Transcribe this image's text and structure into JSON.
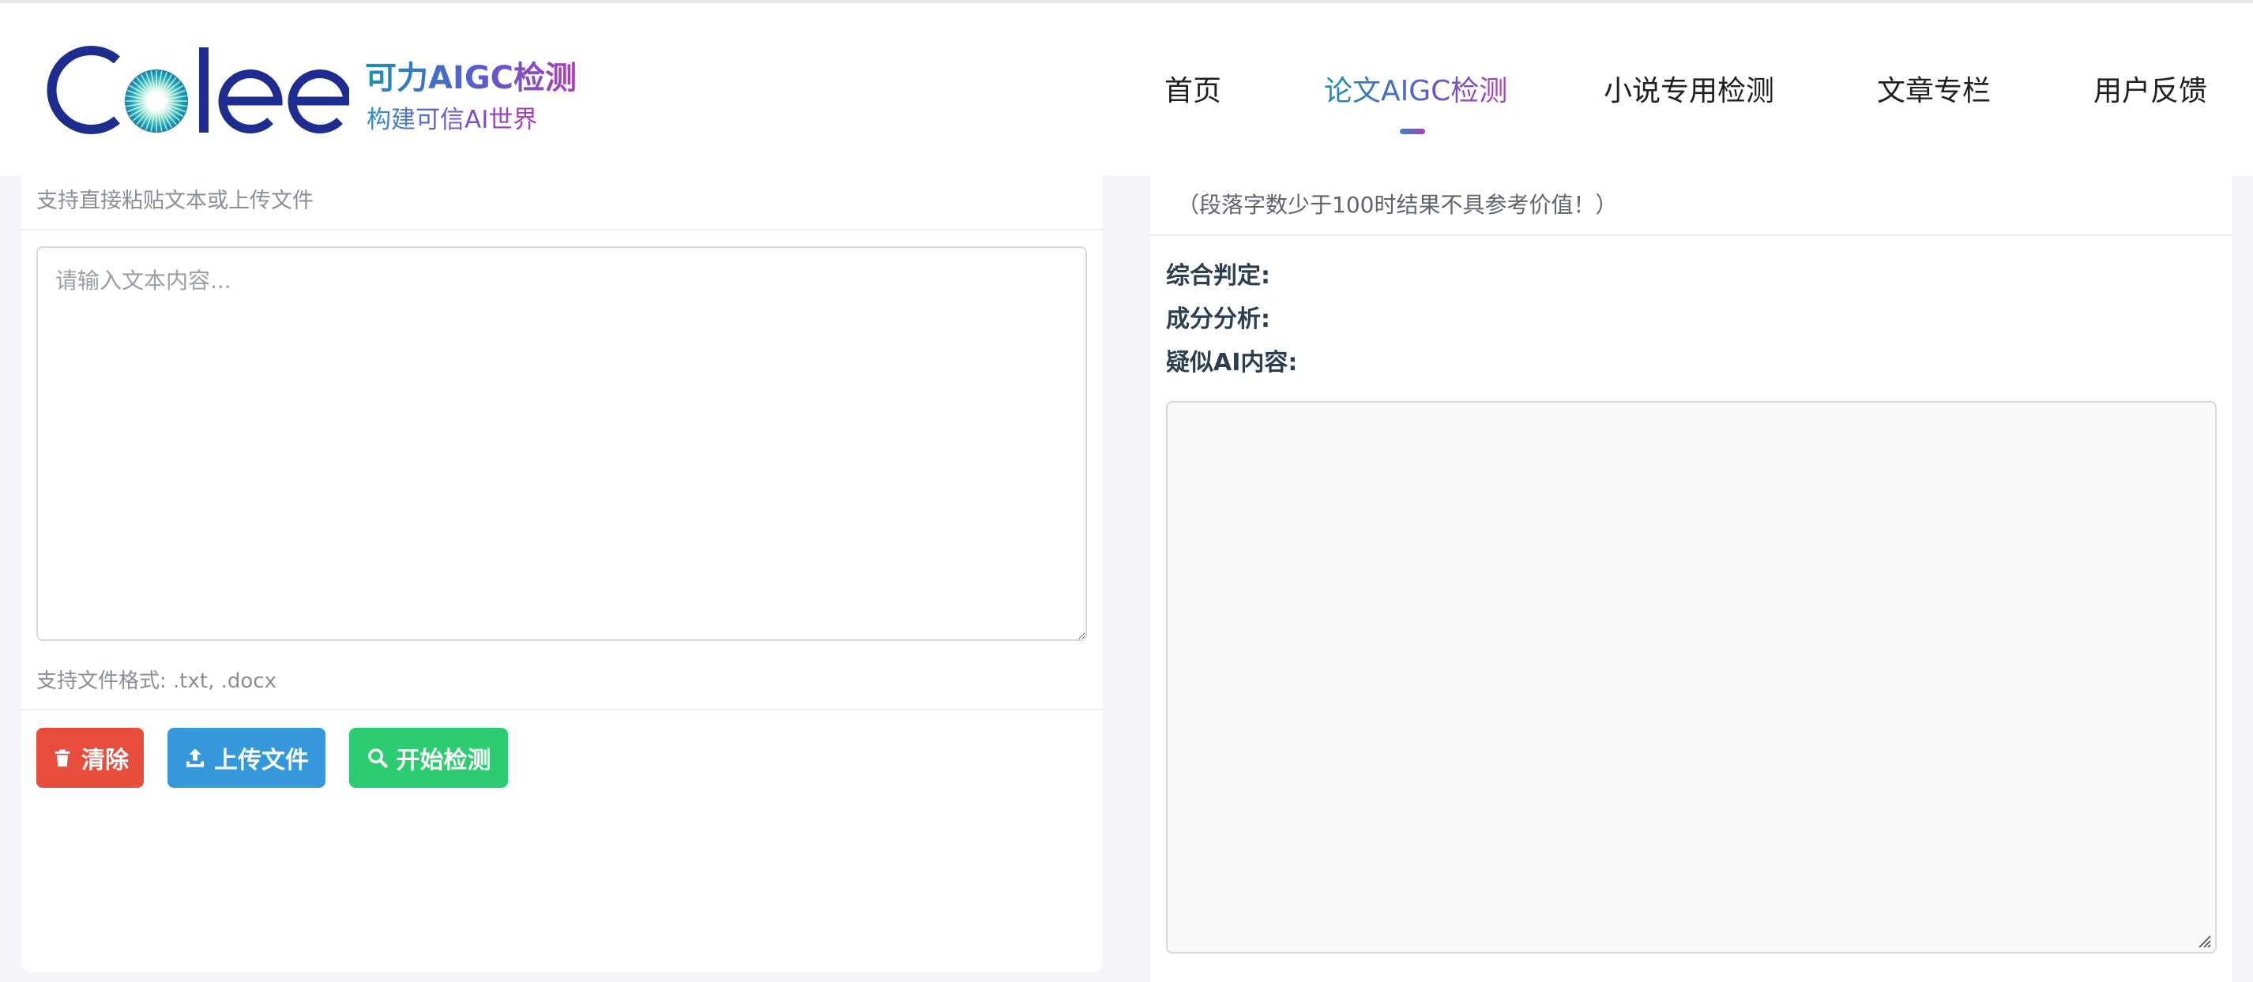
{
  "brand": {
    "logo_text": "Colee",
    "title": "可力AIGC检测",
    "subtitle": "构建可信AI世界"
  },
  "nav": {
    "items": [
      {
        "label": "首页",
        "active": false
      },
      {
        "label": "论文AIGC检测",
        "active": true
      },
      {
        "label": "小说专用检测",
        "active": false
      },
      {
        "label": "文章专栏",
        "active": false
      },
      {
        "label": "用户反馈",
        "active": false
      }
    ]
  },
  "input_panel": {
    "hint": "支持直接粘贴文本或上传文件",
    "placeholder": "请输入文本内容...",
    "formats": "支持文件格式: .txt, .docx",
    "buttons": {
      "clear": "清除",
      "upload": "上传文件",
      "detect": "开始检测"
    }
  },
  "result_panel": {
    "hint": "（段落字数少于100时结果不具参考价值！）",
    "overall_label": "综合判定:",
    "composition_label": "成分分析:",
    "suspected_label": "疑似AI内容:"
  },
  "colors": {
    "clear": "#e74c3c",
    "upload": "#3498db",
    "detect": "#2ecc71",
    "logo_blue": "#1e2b8f"
  },
  "icons": {
    "clear": "trash-icon",
    "upload": "upload-icon",
    "detect": "search-icon"
  }
}
